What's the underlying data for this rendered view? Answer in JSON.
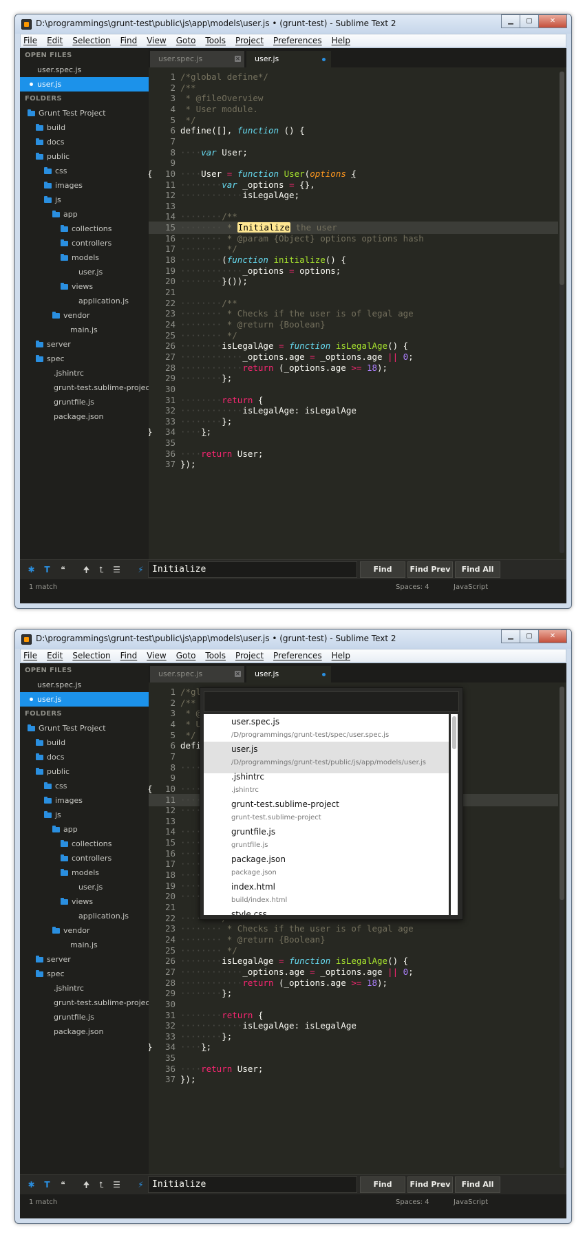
{
  "title": "D:\\programmings\\grunt-test\\public\\js\\app\\models\\user.js • (grunt-test) - Sublime Text 2",
  "window_buttons": {
    "minimize": "▁",
    "maximize": "▢",
    "close": "✕"
  },
  "menu": [
    "File",
    "Edit",
    "Selection",
    "Find",
    "View",
    "Goto",
    "Tools",
    "Project",
    "Preferences",
    "Help"
  ],
  "sidebar": {
    "open_files_header": "OPEN FILES",
    "open_files": [
      "user.spec.js",
      "user.js"
    ],
    "folders_header": "FOLDERS",
    "tree": [
      {
        "label": "Grunt Test Project",
        "folder": true,
        "indent": 0
      },
      {
        "label": "build",
        "folder": true,
        "indent": 1
      },
      {
        "label": "docs",
        "folder": true,
        "indent": 1
      },
      {
        "label": "public",
        "folder": true,
        "indent": 1
      },
      {
        "label": "css",
        "folder": true,
        "indent": 2
      },
      {
        "label": "images",
        "folder": true,
        "indent": 2
      },
      {
        "label": "js",
        "folder": true,
        "indent": 2
      },
      {
        "label": "app",
        "folder": true,
        "indent": 3
      },
      {
        "label": "collections",
        "folder": true,
        "indent": 4
      },
      {
        "label": "controllers",
        "folder": true,
        "indent": 4
      },
      {
        "label": "models",
        "folder": true,
        "indent": 4
      },
      {
        "label": "user.js",
        "folder": false,
        "indent": 5
      },
      {
        "label": "views",
        "folder": true,
        "indent": 4
      },
      {
        "label": "application.js",
        "folder": false,
        "indent": 5
      },
      {
        "label": "vendor",
        "folder": true,
        "indent": 3
      },
      {
        "label": "main.js",
        "folder": false,
        "indent": 4
      },
      {
        "label": "server",
        "folder": true,
        "indent": 1
      },
      {
        "label": "spec",
        "folder": true,
        "indent": 1
      },
      {
        "label": ".jshintrc",
        "folder": false,
        "indent": 2
      },
      {
        "label": "grunt-test.sublime-project",
        "folder": false,
        "indent": 2
      },
      {
        "label": "gruntfile.js",
        "folder": false,
        "indent": 2
      },
      {
        "label": "package.json",
        "folder": false,
        "indent": 2
      }
    ]
  },
  "tabs": [
    {
      "label": "user.spec.js",
      "active": false
    },
    {
      "label": "user.js",
      "active": true
    }
  ],
  "code_lines": [
    [
      [
        "c-com",
        "/*global define*/"
      ]
    ],
    [
      [
        "c-com",
        "/**"
      ]
    ],
    [
      [
        "c-com",
        " * @fileOverview"
      ]
    ],
    [
      [
        "c-com",
        " * User module."
      ]
    ],
    [
      [
        "c-com",
        " */"
      ]
    ],
    [
      [
        "",
        "define([], "
      ],
      [
        "c-st",
        "function"
      ],
      [
        "",
        " () {"
      ]
    ],
    [],
    [
      [
        "c-ws",
        "····"
      ],
      [
        "c-st",
        "var"
      ],
      [
        "",
        " User;"
      ]
    ],
    [],
    [
      [
        "c-ws",
        "····"
      ],
      [
        "",
        "User "
      ],
      [
        "c-kw",
        "="
      ],
      [
        "",
        " "
      ],
      [
        "c-st",
        "function"
      ],
      [
        "",
        " "
      ],
      [
        "c-fn",
        "User"
      ],
      [
        "",
        "("
      ],
      [
        "c-par",
        "options"
      ],
      [
        "",
        " "
      ],
      [
        "ul",
        "{"
      ]
    ],
    [
      [
        "c-ws",
        "········"
      ],
      [
        "c-st",
        "var"
      ],
      [
        "",
        " _options "
      ],
      [
        "c-kw",
        "="
      ],
      [
        "",
        " {},"
      ]
    ],
    [
      [
        "c-ws",
        "············"
      ],
      [
        "",
        "isLegalAge;"
      ]
    ],
    [],
    [
      [
        "c-ws",
        "········"
      ],
      [
        "c-com",
        "/**"
      ]
    ],
    [
      [
        "c-ws",
        "········"
      ],
      [
        "c-com",
        " * "
      ],
      [
        "hl",
        "Initialize"
      ],
      [
        "c-com",
        " the user"
      ]
    ],
    [
      [
        "c-ws",
        "········"
      ],
      [
        "c-com",
        " * @param {Object} options options hash"
      ]
    ],
    [
      [
        "c-ws",
        "········"
      ],
      [
        "c-com",
        " */"
      ]
    ],
    [
      [
        "c-ws",
        "········"
      ],
      [
        "",
        "("
      ],
      [
        "c-st",
        "function"
      ],
      [
        "",
        " "
      ],
      [
        "c-fn",
        "initialize"
      ],
      [
        "",
        "() {"
      ]
    ],
    [
      [
        "c-ws",
        "············"
      ],
      [
        "",
        "_options "
      ],
      [
        "c-kw",
        "="
      ],
      [
        "",
        " options;"
      ]
    ],
    [
      [
        "c-ws",
        "········"
      ],
      [
        "",
        "}());"
      ]
    ],
    [],
    [
      [
        "c-ws",
        "········"
      ],
      [
        "c-com",
        "/**"
      ]
    ],
    [
      [
        "c-ws",
        "········"
      ],
      [
        "c-com",
        " * Checks if the user is of legal age"
      ]
    ],
    [
      [
        "c-ws",
        "········"
      ],
      [
        "c-com",
        " * @return {Boolean}"
      ]
    ],
    [
      [
        "c-ws",
        "········"
      ],
      [
        "c-com",
        " */"
      ]
    ],
    [
      [
        "c-ws",
        "········"
      ],
      [
        "",
        "isLegalAge "
      ],
      [
        "c-kw",
        "="
      ],
      [
        "",
        " "
      ],
      [
        "c-st",
        "function"
      ],
      [
        "",
        " "
      ],
      [
        "c-fn",
        "isLegalAge"
      ],
      [
        "",
        "() {"
      ]
    ],
    [
      [
        "c-ws",
        "············"
      ],
      [
        "",
        "_options.age "
      ],
      [
        "c-kw",
        "="
      ],
      [
        "",
        " _options.age "
      ],
      [
        "c-kw",
        "||"
      ],
      [
        "",
        " "
      ],
      [
        "c-num",
        "0"
      ],
      [
        "",
        ";"
      ]
    ],
    [
      [
        "c-ws",
        "············"
      ],
      [
        "c-kw",
        "return"
      ],
      [
        "",
        " (_options.age "
      ],
      [
        "c-kw",
        ">="
      ],
      [
        "",
        " "
      ],
      [
        "c-num",
        "18"
      ],
      [
        "",
        ");"
      ]
    ],
    [
      [
        "c-ws",
        "········"
      ],
      [
        "",
        "};"
      ]
    ],
    [],
    [
      [
        "c-ws",
        "········"
      ],
      [
        "c-kw",
        "return"
      ],
      [
        "",
        " {"
      ]
    ],
    [
      [
        "c-ws",
        "············"
      ],
      [
        "",
        "isLegalAge: isLegalAge"
      ]
    ],
    [
      [
        "c-ws",
        "········"
      ],
      [
        "",
        "};"
      ]
    ],
    [
      [
        "c-ws",
        "····"
      ],
      [
        "ul",
        "}"
      ],
      [
        "",
        ";"
      ]
    ],
    [],
    [
      [
        "c-ws",
        "····"
      ],
      [
        "c-kw",
        "return"
      ],
      [
        "",
        " User;"
      ]
    ],
    [
      [
        "",
        "});"
      ]
    ]
  ],
  "fold_markers": {
    "10": "{",
    "34": "}"
  },
  "find_bar": {
    "query": "Initialize",
    "icons": [
      "✱",
      "T",
      "❝",
      "🠉",
      "⮤",
      "☰",
      "⚡"
    ],
    "buttons": [
      "Find",
      "Find Prev",
      "Find All"
    ]
  },
  "status": {
    "left": "1 match",
    "spaces": "Spaces: 4",
    "syntax": "JavaScript"
  },
  "goto_overlay": {
    "items": [
      {
        "name": "user.spec.js",
        "path": "/D/programmings/grunt-test/spec/user.spec.js"
      },
      {
        "name": "user.js",
        "path": "/D/programmings/grunt-test/public/js/app/models/user.js"
      },
      {
        "name": ".jshintrc",
        "path": ".jshintrc"
      },
      {
        "name": "grunt-test.sublime-project",
        "path": "grunt-test.sublime-project"
      },
      {
        "name": "gruntfile.js",
        "path": "gruntfile.js"
      },
      {
        "name": "package.json",
        "path": "package.json"
      },
      {
        "name": "index.html",
        "path": "build/index.html"
      },
      {
        "name": "style.css",
        "path": ""
      }
    ],
    "selected_index": 1
  }
}
